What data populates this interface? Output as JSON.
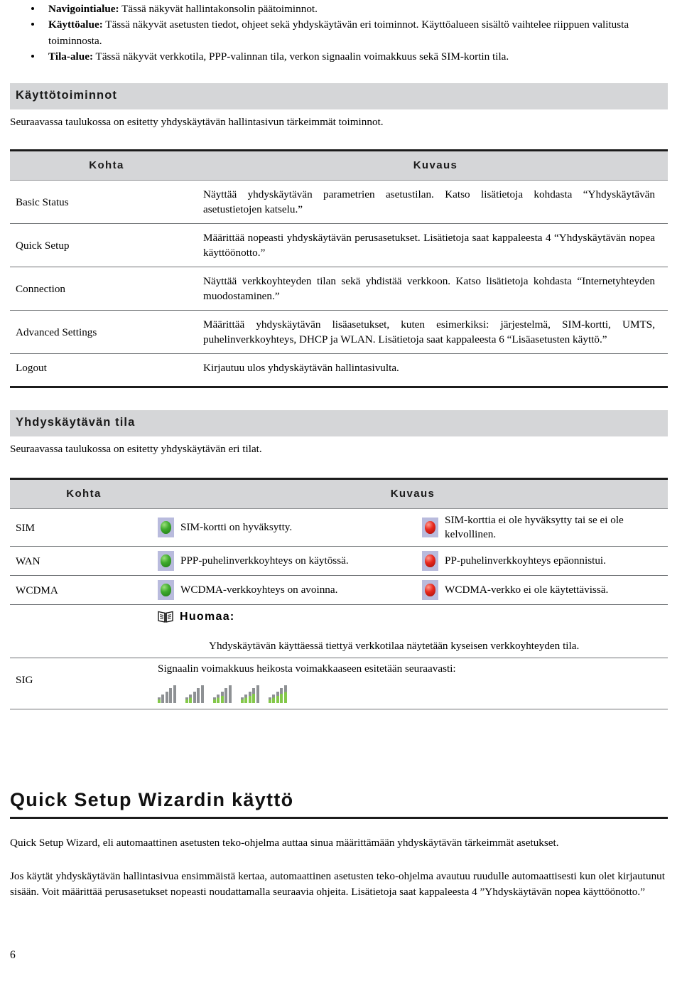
{
  "intro_bullets": [
    {
      "term": "Navigointialue:",
      "text": " Tässä näkyvät hallintakonsolin päätoiminnot."
    },
    {
      "term": "Käyttöalue:",
      "text": " Tässä näkyvät asetusten tiedot, ohjeet sekä yhdyskäytävän eri toiminnot. Käyttöalueen sisältö vaihtelee riippuen valitusta toiminnosta."
    },
    {
      "term": "Tila-alue:",
      "text": " Tässä näkyvät verkkotila, PPP-valinnan tila, verkon signaalin voimakkuus sekä SIM-kortin tila."
    }
  ],
  "section_functions": {
    "heading": "Käyttötoiminnot",
    "intro": "Seuraavassa taulukossa on esitetty yhdyskäytävän hallintasivun tärkeimmät toiminnot.",
    "columns": [
      "Kohta",
      "Kuvaus"
    ],
    "rows": [
      {
        "key": "Basic Status",
        "desc": "Näyttää yhdyskäytävän parametrien asetustilan. Katso lisätietoja kohdasta “Yhdyskäytävän asetustietojen katselu.”"
      },
      {
        "key": "Quick Setup",
        "desc": "Määrittää nopeasti yhdyskäytävän perusasetukset. Lisätietoja saat kappaleesta 4 “Yhdyskäytävän nopea käyttöönotto.”"
      },
      {
        "key": "Connection",
        "desc": "Näyttää verkkoyhteyden tilan sekä yhdistää verkkoon. Katso lisätietoja kohdasta “Internetyhteyden muodostaminen.”"
      },
      {
        "key": "Advanced Settings",
        "desc": "Määrittää yhdyskäytävän lisäasetukset, kuten esimerkiksi: järjestelmä, SIM-kortti, UMTS, puhelinverkkoyhteys, DHCP ja WLAN. Lisätietoja saat kappaleesta 6 “Lisäasetusten käyttö.”"
      },
      {
        "key": "Logout",
        "desc": "Kirjautuu ulos yhdyskäytävän hallintasivulta."
      }
    ]
  },
  "section_status": {
    "heading": "Yhdyskäytävän tila",
    "intro": "Seuraavassa taulukossa on esitetty yhdyskäytävän eri tilat.",
    "columns": [
      "Kohta",
      "Kuvaus"
    ],
    "rows": [
      {
        "key": "SIM",
        "ok_icon": "green-led-icon",
        "ok_text": "SIM-kortti on hyväksytty.",
        "err_icon": "red-led-icon",
        "err_text": "SIM-korttia ei ole hyväksytty tai se ei ole kelvollinen."
      },
      {
        "key": "WAN",
        "ok_icon": "green-led-icon",
        "ok_text": "PPP-puhelinverkkoyhteys on käytössä.",
        "err_icon": "red-led-icon",
        "err_text": "PP-puhelinverkkoyhteys epäonnistui."
      },
      {
        "key": "WCDMA",
        "ok_icon": "green-led-icon",
        "ok_text": "WCDMA-verkkoyhteys on avoinna.",
        "err_icon": "red-led-icon",
        "err_text": "WCDMA-verkko ei ole käytettävissä."
      }
    ],
    "note": {
      "icon": "open-book-icon",
      "label": "Huomaa:",
      "text": "Yhdyskäytävän käyttäessä tiettyä verkkotilaa näytetään kyseisen verkkoyhteyden tila."
    },
    "sig_row": {
      "key": "SIG",
      "text": "Signaalin voimakkuus heikosta voimakkaaseen esitetään seuraavasti:",
      "icons": [
        "signal-1-icon",
        "signal-2-icon",
        "signal-3-icon",
        "signal-4-icon",
        "signal-5-icon"
      ],
      "levels": [
        1,
        2,
        3,
        4,
        5
      ]
    }
  },
  "section_wizard": {
    "heading": "Quick Setup Wizardin käyttö",
    "paragraph1": "Quick Setup Wizard, eli automaattinen asetusten teko-ohjelma auttaa sinua määrittämään yhdyskäytävän tärkeimmät asetukset.",
    "paragraph2": "Jos käytät yhdyskäytävän hallintasivua ensimmäistä kertaa, automaattinen asetusten teko-ohjelma avautuu ruudulle automaattisesti kun olet kirjautunut sisään. Voit määrittää perusasetukset nopeasti noudattamalla seuraavia ohjeita. Lisätietoja saat kappaleesta 4 ”Yhdyskäytävän nopea käyttöönotto.”"
  },
  "footer": {
    "page_number": "6"
  },
  "colors": {
    "band_gray": "#d5d6d8",
    "rule_dark": "#1c1c1c",
    "rule_mid": "#6d7073",
    "led_bg": "#b9bbdd",
    "led_green": "#3faa2e",
    "led_red": "#e8291f",
    "signal_bar_active": "#84c84a",
    "signal_bar_inactive": "#8e9194"
  }
}
